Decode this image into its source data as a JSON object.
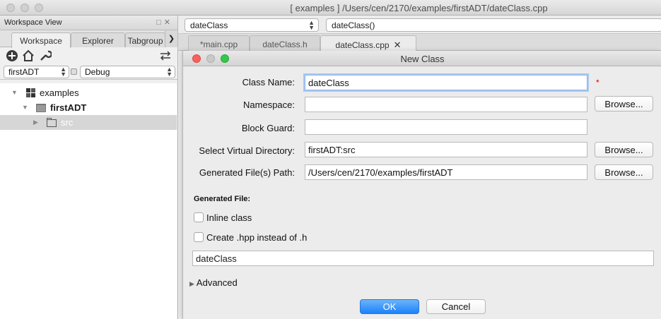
{
  "window": {
    "title": "[ examples ] /Users/cen/2170/examples/firstADT/dateClass.cpp"
  },
  "workspace_panel": {
    "title": "Workspace View",
    "tabs": [
      {
        "label": "Workspace",
        "active": true
      },
      {
        "label": "Explorer",
        "active": false
      },
      {
        "label": "Tabgroup",
        "active": false
      }
    ],
    "toolbar_icons": [
      "add-icon",
      "home-icon",
      "wrench-icon",
      "swap-arrows-icon"
    ],
    "project_select": "firstADT",
    "config_select": "Debug",
    "tree": [
      {
        "label": "examples",
        "icon": "workspace-icon",
        "expanded": true
      },
      {
        "label": "firstADT",
        "icon": "project-folder-icon",
        "expanded": true,
        "bold": true
      },
      {
        "label": "src",
        "icon": "virtual-folder-icon",
        "expanded": false,
        "selected": true
      }
    ]
  },
  "editor": {
    "class_combo": "dateClass",
    "function_combo": "dateClass()",
    "file_tabs": [
      {
        "label": "*main.cpp",
        "active": false
      },
      {
        "label": "dateClass.h",
        "active": false
      },
      {
        "label": "dateClass.cpp",
        "active": true,
        "close": "✕"
      }
    ]
  },
  "dialog": {
    "title": "New Class",
    "fields": {
      "class_name_label": "Class Name:",
      "class_name_value": "dateClass",
      "required_marker": "*",
      "namespace_label": "Namespace:",
      "namespace_value": "",
      "block_guard_label": "Block Guard:",
      "block_guard_value": "",
      "virtual_dir_label": "Select Virtual Directory:",
      "virtual_dir_value": "firstADT:src",
      "generated_path_label": "Generated File(s) Path:",
      "generated_path_value": "/Users/cen/2170/examples/firstADT"
    },
    "browse_label": "Browse...",
    "generated_file_heading": "Generated File:",
    "inline_class_label": "Inline class",
    "inline_class_checked": false,
    "create_hpp_label": "Create .hpp instead of .h",
    "create_hpp_checked": false,
    "file_name_value": "dateClass",
    "advanced_label": "Advanced",
    "ok_label": "OK",
    "cancel_label": "Cancel"
  },
  "colors": {
    "ok_button": "#1a82fb",
    "focus_ring": "#a9c9f3",
    "close_light": "#fc605b",
    "minimize_light": "#c9c9c9",
    "zoom_light": "#34c84a",
    "required": "#d40000"
  }
}
